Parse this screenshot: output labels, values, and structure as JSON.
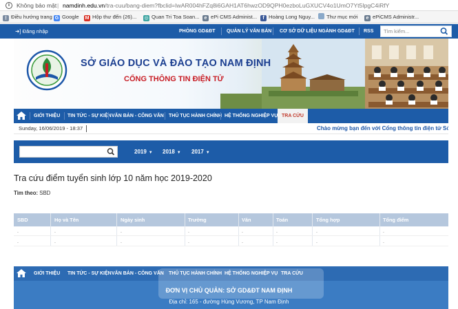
{
  "browser": {
    "security_label": "Không bảo mật",
    "url_host": "namdinh.edu.vn",
    "url_path": "/tra-cuu/bang-diem?fbclid=IwAR004hFZq8i6GAH1AT6hwzOD9QPH0ezboLuGXUCV4o1UmO7Yt5IpgC4iRfY"
  },
  "bookmarks": [
    {
      "label": "Điều hướng trang",
      "icon": "apps-icon"
    },
    {
      "label": "Google",
      "icon": "google-icon"
    },
    {
      "label": "Hộp thư đến (26)...",
      "icon": "gmail-icon"
    },
    {
      "label": "Quan Tri Toa Soan...",
      "icon": "globe-icon"
    },
    {
      "label": "ePi CMS Administ...",
      "icon": "epi-icon"
    },
    {
      "label": "Hoàng Long Nguy...",
      "icon": "facebook-icon"
    },
    {
      "label": "Thư mục mới",
      "icon": "folder-icon"
    },
    {
      "label": "ePiCMS Administr...",
      "icon": "epi-icon"
    }
  ],
  "topbar": {
    "login": "Đăng nhập",
    "links": [
      "PHÒNG GD&ĐT",
      "QUẢN LÝ VĂN BẢN",
      "CƠ SỞ DỮ LIỆU NGÀNH GD&ĐT",
      "RSS"
    ],
    "search_placeholder": "Tìm kiếm..."
  },
  "banner": {
    "title": "SỞ GIÁO DỤC VÀ ĐÀO TẠO NAM ĐỊNH",
    "subtitle": "CỔNG THÔNG TIN ĐIỆN TỬ"
  },
  "nav": {
    "items": [
      "GIỚI THIỆU",
      "TIN TỨC - SỰ KIỆN",
      "VĂN BẢN - CÔNG VĂN",
      "THỦ TỤC HÀNH CHÍNH",
      "HỆ THỐNG NGHIỆP VỤ",
      "TRA CỨU"
    ]
  },
  "info": {
    "date": "Sunday, 16/06/2019 - 18:37",
    "marquee": "Chào mừng bạn đến với Cổng thông tin điện tử Sở G"
  },
  "search": {
    "years": [
      "2019",
      "2018",
      "2017"
    ]
  },
  "page": {
    "title": "Tra cứu điểm tuyển sinh lớp 10 năm học 2019-2020",
    "filter_label": "Tìm theo:",
    "filter_value": "SBD"
  },
  "table": {
    "headers": [
      "SBD",
      "Họ và Tên",
      "Ngày sinh",
      "Trường",
      "Văn",
      "Toán",
      "Tổng hợp",
      "Tổng điểm"
    ],
    "rows": [
      [
        ".",
        ".",
        ".",
        ".",
        ".",
        ".",
        ".",
        "."
      ],
      [
        ".",
        ".",
        ".",
        ".",
        ".",
        ".",
        ".",
        "."
      ]
    ]
  },
  "footer": {
    "nav": [
      "GIỚI THIỆU",
      "TIN TỨC - SỰ KIỆN",
      "VĂN BẢN - CÔNG VĂN",
      "THỦ TỤC HÀNH CHÍNH",
      "HỆ THỐNG NGHIỆP VỤ",
      "TRA CỨU"
    ],
    "owner": "ĐƠN VỊ CHỦ QUẢN: SỞ GD&ĐT NAM ĐỊNH",
    "address": "Địa chỉ: 165 - đường Hùng Vương, TP Nam Định"
  },
  "colors": {
    "primary": "#1d5ca8",
    "accent_red": "#c81d25",
    "table_header": "#b5c7dd",
    "footer": "#3b7cc3"
  }
}
